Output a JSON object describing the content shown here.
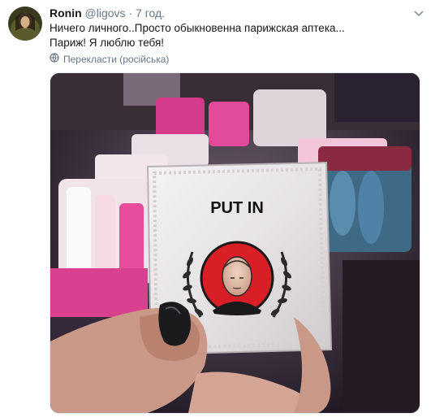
{
  "tweet": {
    "author_name": "Ronin",
    "author_handle": "@ligovs",
    "separator": "·",
    "time": "7 год.",
    "text_line1": "Ничего личного..Просто обыкновенна парижская аптека...",
    "text_line2": "Париж! Я люблю тебя!",
    "translate_label": "Перекласти (російська)"
  },
  "photo": {
    "condom_text": "PUT IN"
  },
  "icons": {
    "caret": "chevron-down-icon",
    "translate": "globe-icon",
    "avatar": "avatar"
  },
  "colors": {
    "text": "#14171a",
    "secondary": "#657786",
    "border": "#e1e8ed"
  }
}
